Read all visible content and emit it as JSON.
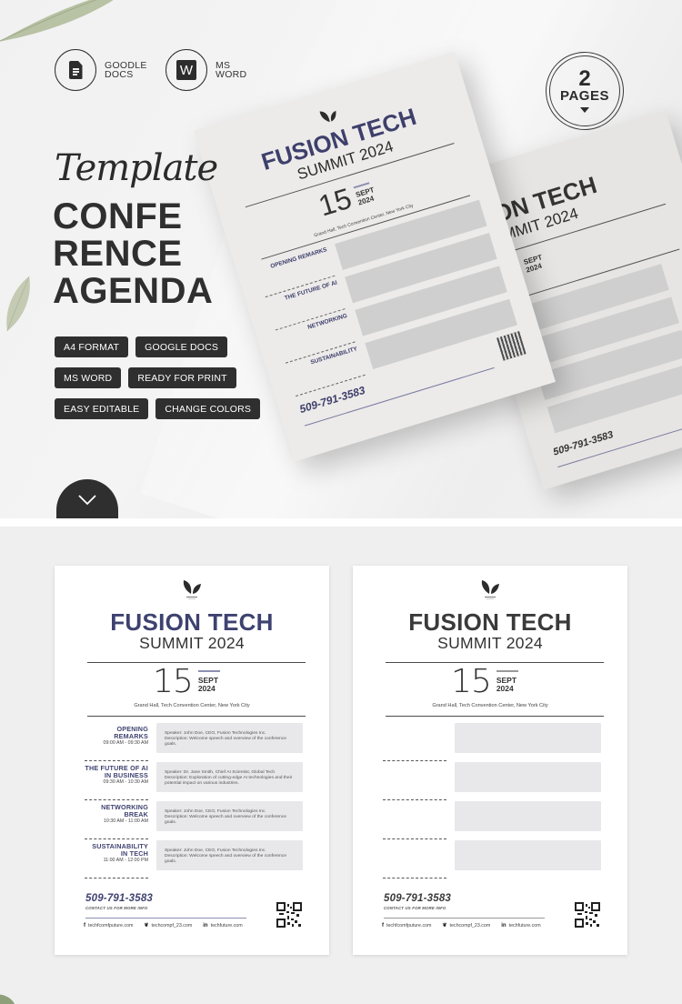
{
  "hero": {
    "formats": [
      {
        "label_line1": "GOODLE",
        "label_line2": "DOCS",
        "icon": "google-docs-icon"
      },
      {
        "label_line1": "MS",
        "label_line2": "WORD",
        "icon": "ms-word-icon",
        "glyph": "W"
      }
    ],
    "pages_badge": {
      "number": "2",
      "word": "PAGES"
    },
    "script_title": "Template",
    "title_lines": [
      "CONFE",
      "RENCE",
      "AGENDA"
    ],
    "tags": [
      [
        "A4 FORMAT",
        "GOOGLE DOCS"
      ],
      [
        "MS WORD",
        "READY FOR PRINT"
      ],
      [
        "EASY EDITABLE",
        "CHANGE COLORS"
      ]
    ],
    "scroll_button_icon": "chevron-down-icon"
  },
  "template": {
    "title": "FUSION TECH",
    "subtitle": "SUMMIT 2024",
    "day": "15",
    "month": "SEPT",
    "year": "2024",
    "venue": "Grand Hall, Tech Convention Center, New York City",
    "agenda": [
      {
        "title_lines": [
          "OPENING REMARKS"
        ],
        "time": "09:00 AM - 09:30 AM",
        "speaker": "Speaker: John Doe, CEO, Fusion Technologies Inc.",
        "description": "Description: Welcome speech and overview of the conference goals."
      },
      {
        "title_lines": [
          "THE FUTURE OF AI",
          "IN BUSINESS"
        ],
        "time": "09:30 AM - 10:30 AM",
        "speaker": "Speaker: Dr. Jane Smith, Chief AI Scientist, Global Tech",
        "description": "Description: Exploration of cutting-edge AI technologies and their potential impact on various industries."
      },
      {
        "title_lines": [
          "NETWORKING",
          "BREAK"
        ],
        "time": "10:30 AM - 11:00 AM",
        "speaker": "Speaker: John Doe, CEO, Fusion Technologies Inc.",
        "description": "Description: Welcome speech and overview of the conference goals."
      },
      {
        "title_lines": [
          "SUSTAINABILITY",
          "IN TECH"
        ],
        "time": "11:00 AM - 12:00 PM",
        "speaker": "Speaker: John Doe, CEO, Fusion Technologies Inc.",
        "description": "Description: Welcome speech and overview of the conference goals."
      }
    ],
    "phone": "509-791-3583",
    "contact_label": "CONTACT US FOR MORE INFO",
    "socials": [
      {
        "icon": "facebook-icon",
        "glyph": "f",
        "text": "techfcomfputure.com"
      },
      {
        "icon": "twitter-icon",
        "glyph": "❦",
        "text": "techcompf_23.com"
      },
      {
        "icon": "linkedin-icon",
        "glyph": "in",
        "text": "techfuture.com"
      }
    ]
  },
  "colors": {
    "accent_navy": "#3e4270",
    "dark": "#2f2f2f",
    "background": "#efefef",
    "agenda_box": "#e8e8eb"
  }
}
